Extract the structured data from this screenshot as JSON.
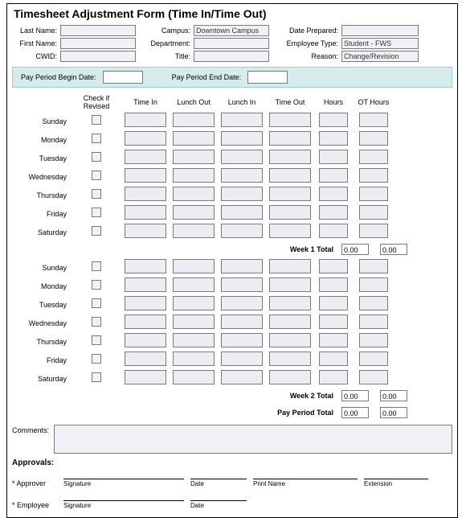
{
  "title": "Timesheet Adjustment Form (Time In/Time Out)",
  "top": {
    "lastName": {
      "label": "Last Name:",
      "value": ""
    },
    "firstName": {
      "label": "First Name:",
      "value": ""
    },
    "cwid": {
      "label": "CWID:",
      "value": ""
    },
    "campus": {
      "label": "Campus:",
      "value": "Downtown Campus"
    },
    "department": {
      "label": "Department:",
      "value": ""
    },
    "jobTitle": {
      "label": "Title:",
      "value": ""
    },
    "datePrepared": {
      "label": "Date Prepared:",
      "value": ""
    },
    "employeeType": {
      "label": "Employee Type:",
      "value": "Student - FWS"
    },
    "reason": {
      "label": "Reason:",
      "value": "Change/Revision"
    }
  },
  "period": {
    "beginLabel": "Pay Period Begin Date:",
    "endLabel": "Pay Period End Date:"
  },
  "headers": {
    "revised": "Check if Revised",
    "timeIn": "Time In",
    "lunchOut": "Lunch Out",
    "lunchIn": "Lunch In",
    "timeOut": "Time Out",
    "hours": "Hours",
    "otHours": "OT Hours"
  },
  "days": [
    "Sunday",
    "Monday",
    "Tuesday",
    "Wednesday",
    "Thursday",
    "Friday",
    "Saturday"
  ],
  "totals": {
    "week1": {
      "label": "Week 1 Total",
      "hours": "0.00",
      "ot": "0.00"
    },
    "week2": {
      "label": "Week 2 Total",
      "hours": "0.00",
      "ot": "0.00"
    },
    "payPeriod": {
      "label": "Pay Period Total",
      "hours": "0.00",
      "ot": "0.00"
    }
  },
  "comments": {
    "label": "Comments:"
  },
  "approvals": {
    "title": "Approvals:",
    "approver": "* Approver",
    "employee": "* Employee",
    "signature": "Signature",
    "date": "Date",
    "printName": "Print Name",
    "extension": "Extension"
  }
}
